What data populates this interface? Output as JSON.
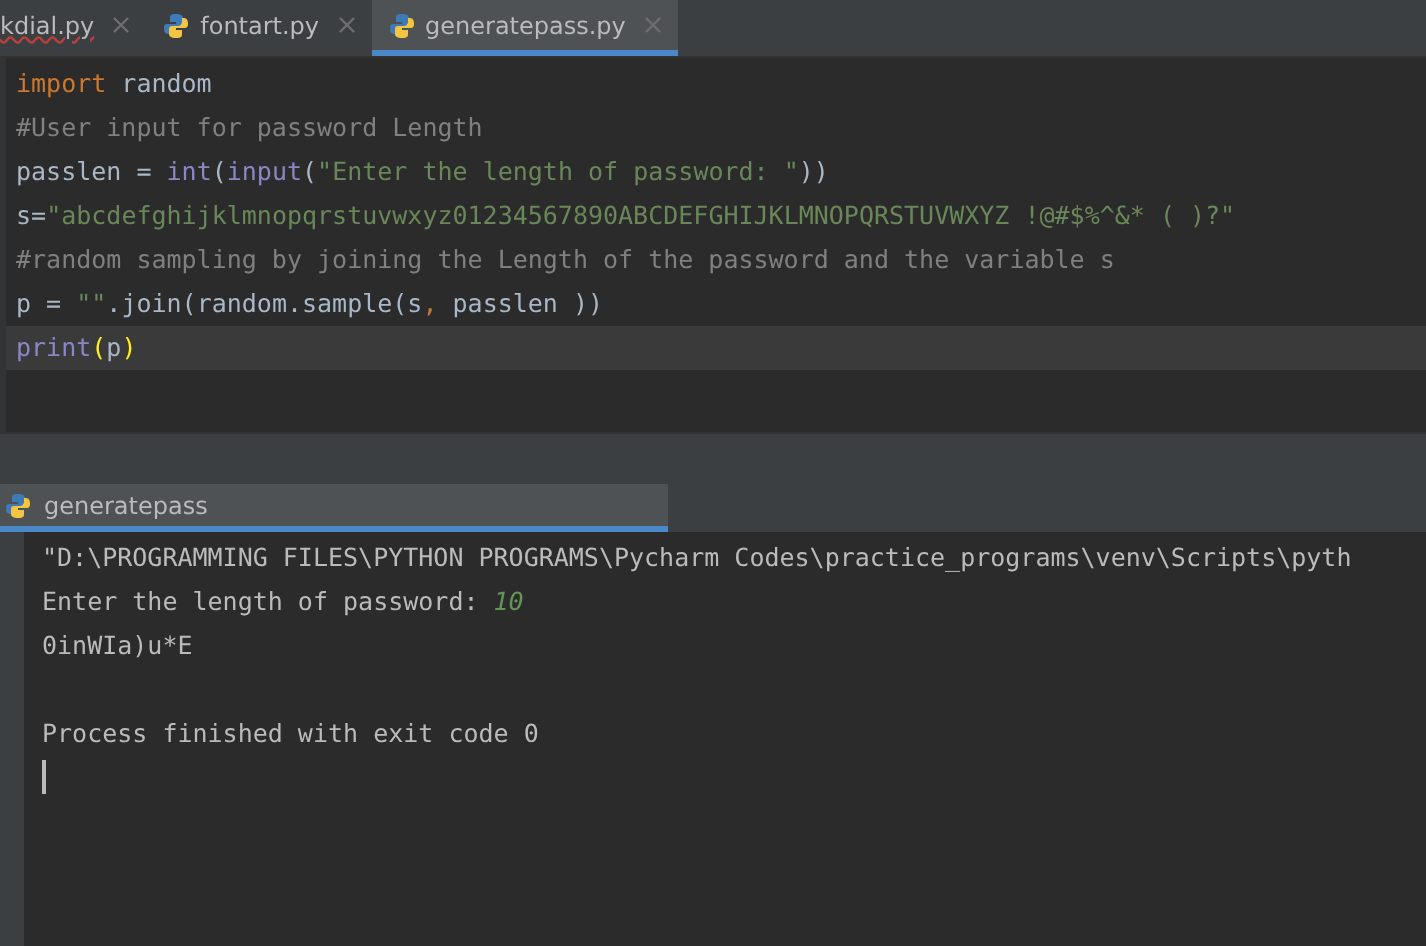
{
  "editor_tabs": [
    {
      "label": "kdial.py",
      "selected": false,
      "error": true,
      "partial": true
    },
    {
      "label": "fontart.py",
      "selected": false,
      "error": false,
      "partial": false
    },
    {
      "label": "generatepass.py",
      "selected": true,
      "error": false,
      "partial": false
    }
  ],
  "code_lines": [
    {
      "current": false,
      "tokens": [
        {
          "text": "import",
          "kind": "keyword"
        },
        {
          "text": " random",
          "kind": "plain"
        }
      ]
    },
    {
      "current": false,
      "tokens": [
        {
          "text": "#User input for password Length",
          "kind": "comment"
        }
      ]
    },
    {
      "current": false,
      "tokens": [
        {
          "text": "passlen = ",
          "kind": "plain"
        },
        {
          "text": "int",
          "kind": "builtin"
        },
        {
          "text": "(",
          "kind": "plain"
        },
        {
          "text": "input",
          "kind": "builtin"
        },
        {
          "text": "(",
          "kind": "plain"
        },
        {
          "text": "\"Enter the length of password: \"",
          "kind": "string"
        },
        {
          "text": "))",
          "kind": "plain"
        }
      ]
    },
    {
      "current": false,
      "tokens": [
        {
          "text": "s=",
          "kind": "plain"
        },
        {
          "text": "\"abcdefghijklmnopqrstuvwxyz01234567890ABCDEFGHIJKLMNOPQRSTUVWXYZ !@#$%^&* ( )?\"",
          "kind": "string"
        }
      ]
    },
    {
      "current": false,
      "tokens": [
        {
          "text": "#random sampling by joining the Length of the password and the variable s",
          "kind": "comment"
        }
      ]
    },
    {
      "current": false,
      "tokens": [
        {
          "text": "p = ",
          "kind": "plain"
        },
        {
          "text": "\"\"",
          "kind": "string"
        },
        {
          "text": ".join(random.sample(s",
          "kind": "plain"
        },
        {
          "text": ",",
          "kind": "keyword"
        },
        {
          "text": " passlen ))",
          "kind": "plain"
        }
      ]
    },
    {
      "current": true,
      "tokens": [
        {
          "text": "print",
          "kind": "builtin"
        },
        {
          "text": "(",
          "kind": "brace"
        },
        {
          "text": "p",
          "kind": "plain"
        },
        {
          "text": ")",
          "kind": "brace"
        }
      ]
    }
  ],
  "run_tab": {
    "label": "generatepass",
    "selected": true
  },
  "console_lines": [
    {
      "kind": "command",
      "text": "\"D:\\PROGRAMMING FILES\\PYTHON PROGRAMS\\Pycharm Codes\\practice_programs\\venv\\Scripts\\pyth"
    },
    {
      "kind": "prompt",
      "text": "Enter the length of password: ",
      "input": "10"
    },
    {
      "kind": "output",
      "text": "0inWIa)u*E"
    },
    {
      "kind": "blank"
    },
    {
      "kind": "output",
      "text": "Process finished with exit code 0"
    }
  ]
}
